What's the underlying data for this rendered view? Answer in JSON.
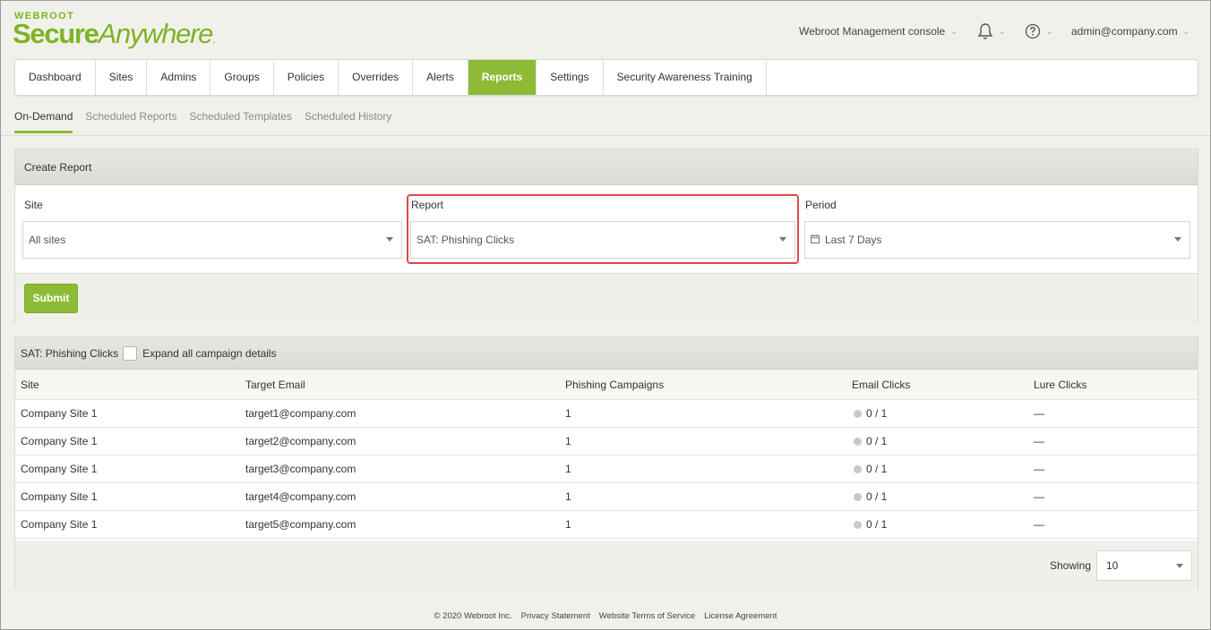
{
  "brand": {
    "top": "WEBROOT",
    "main_bold": "Secure",
    "main_italic": "Anywhere",
    "mark": "."
  },
  "header": {
    "console_label": "Webroot Management console",
    "user_label": "admin@company.com"
  },
  "nav": {
    "tabs": [
      "Dashboard",
      "Sites",
      "Admins",
      "Groups",
      "Policies",
      "Overrides",
      "Alerts",
      "Reports",
      "Settings",
      "Security Awareness Training"
    ],
    "active": "Reports"
  },
  "subnav": {
    "tabs": [
      "On-Demand",
      "Scheduled Reports",
      "Scheduled Templates",
      "Scheduled History"
    ],
    "active": "On-Demand"
  },
  "create_report": {
    "title": "Create Report",
    "site_label": "Site",
    "site_value": "All sites",
    "report_label": "Report",
    "report_value": "SAT: Phishing Clicks",
    "period_label": "Period",
    "period_value": "Last 7 Days",
    "submit_label": "Submit"
  },
  "results": {
    "title": "SAT: Phishing Clicks",
    "expand_label": "Expand all campaign details",
    "columns": [
      "Site",
      "Target Email",
      "Phishing Campaigns",
      "Email Clicks",
      "Lure Clicks"
    ],
    "rows": [
      [
        "Company Site 1",
        "target1@company.com",
        "1",
        "0 / 1",
        "—"
      ],
      [
        "Company Site 1",
        "target2@company.com",
        "1",
        "0 / 1",
        "—"
      ],
      [
        "Company Site 1",
        "target3@company.com",
        "1",
        "0 / 1",
        "—"
      ],
      [
        "Company Site 1",
        "target4@company.com",
        "1",
        "0 / 1",
        "—"
      ],
      [
        "Company Site 1",
        "target5@company.com",
        "1",
        "0 / 1",
        "—"
      ]
    ],
    "showing_label": "Showing",
    "page_size": "10"
  },
  "footer": {
    "copyright": "© 2020 Webroot Inc.",
    "links": [
      "Privacy Statement",
      "Website Terms of Service",
      "License Agreement"
    ]
  },
  "colors": {
    "accent": "#8dbb35",
    "brand": "#7fb324",
    "highlight": "#e0474c"
  },
  "icons": {
    "bell": "bell-icon",
    "help": "help-icon",
    "calendar": "calendar-icon"
  }
}
